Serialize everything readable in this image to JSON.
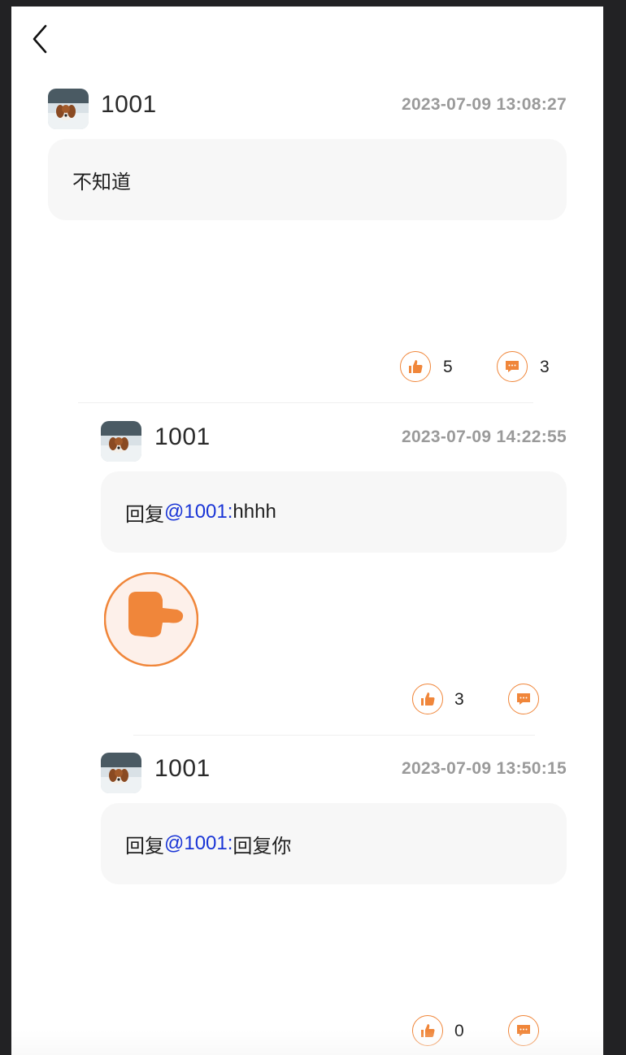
{
  "nav": {
    "back_icon": "chevron-left-icon"
  },
  "comments": [
    {
      "username": "1001",
      "timestamp": "2023-07-09 13:08:27",
      "content": "不知道",
      "likes": "5",
      "replies": "3"
    },
    {
      "username": "1001",
      "timestamp": "2023-07-09 14:22:55",
      "reply_prefix": "回复",
      "mention": "@1001:",
      "content": "hhhh",
      "attachment": "thumbs-up-sticker",
      "likes": "3",
      "replies": ""
    },
    {
      "username": "1001",
      "timestamp": "2023-07-09 13:50:15",
      "reply_prefix": "回复",
      "mention": "@1001:",
      "content": "回复你",
      "likes": "0",
      "replies": ""
    }
  ],
  "colors": {
    "accent": "#f0863a",
    "mention": "#1a35d6",
    "timestamp": "#9a9a9a",
    "bubble": "#f7f7f7"
  },
  "icons": {
    "like": "thumbs-up-icon",
    "comment": "comment-bubble-icon",
    "avatar": "dog-avatar"
  }
}
